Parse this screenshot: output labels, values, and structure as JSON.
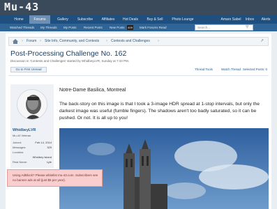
{
  "site": {
    "logo": "Mu-43"
  },
  "nav": {
    "tabs": [
      {
        "label": "Home"
      },
      {
        "label": "Forums"
      },
      {
        "label": "Gallery"
      },
      {
        "label": "Subscribe"
      },
      {
        "label": "Affiliates"
      },
      {
        "label": "Hot Deals"
      },
      {
        "label": "Buy & Sell"
      },
      {
        "label": "Photo Lounge"
      }
    ],
    "user": {
      "name": "Amaro Sabel",
      "inbox": "Inbox",
      "alerts": "Alerts"
    }
  },
  "subnav": {
    "items": [
      {
        "label": "Watched Threads"
      },
      {
        "label": "My Threads"
      },
      {
        "label": "My Posts"
      },
      {
        "label": "Recent Posts"
      },
      {
        "label": "New Posts"
      },
      {
        "label": "Mark Forums Read"
      }
    ],
    "new_posts_count": "409",
    "search_placeholder": "Search..."
  },
  "breadcrumb": {
    "items": [
      {
        "label": "Forum"
      },
      {
        "label": "Site Info, Community, and Contests"
      },
      {
        "label": "Contests and Challenges"
      }
    ]
  },
  "thread": {
    "title": "Post-Processing Challenge No. 162",
    "meta": "Discussion in 'Contests and Challenges' started by WhidbeyLVR, Sunday at 7:43 PM.",
    "unread_button": "Go to First Unread",
    "tools": {
      "thread_tools": "Thread Tools",
      "watch": "Watch Thread",
      "selected": "Selected Posts: 0"
    }
  },
  "post": {
    "author": {
      "name": "WhidbeyLVR",
      "title": "Mu-43 Veteran",
      "stats": [
        {
          "label": "Joined:",
          "value": "Feb 14, 2014"
        },
        {
          "label": "Messages:",
          "value": "329"
        },
        {
          "label": "Location:",
          "value": ""
        },
        {
          "label": "",
          "value": "Whidbey Island"
        },
        {
          "label": "Real Name:",
          "value": "Lyle"
        }
      ]
    },
    "heading": "Notre-Dame Basilica, Montreal",
    "body": "The back-story on this image is that I took a 3-image HDR spread at 1-stop intervals, but only the darkest image was useful (fumble fingers). The shadows aren't too badly saturated, so it can be pushed. Or not. It is all up to you!"
  },
  "adblock": {
    "text": "Using AdBlock? Please whitelist mu-43.com. Subscribers see no banner ads at all (just $5 per year)."
  }
}
